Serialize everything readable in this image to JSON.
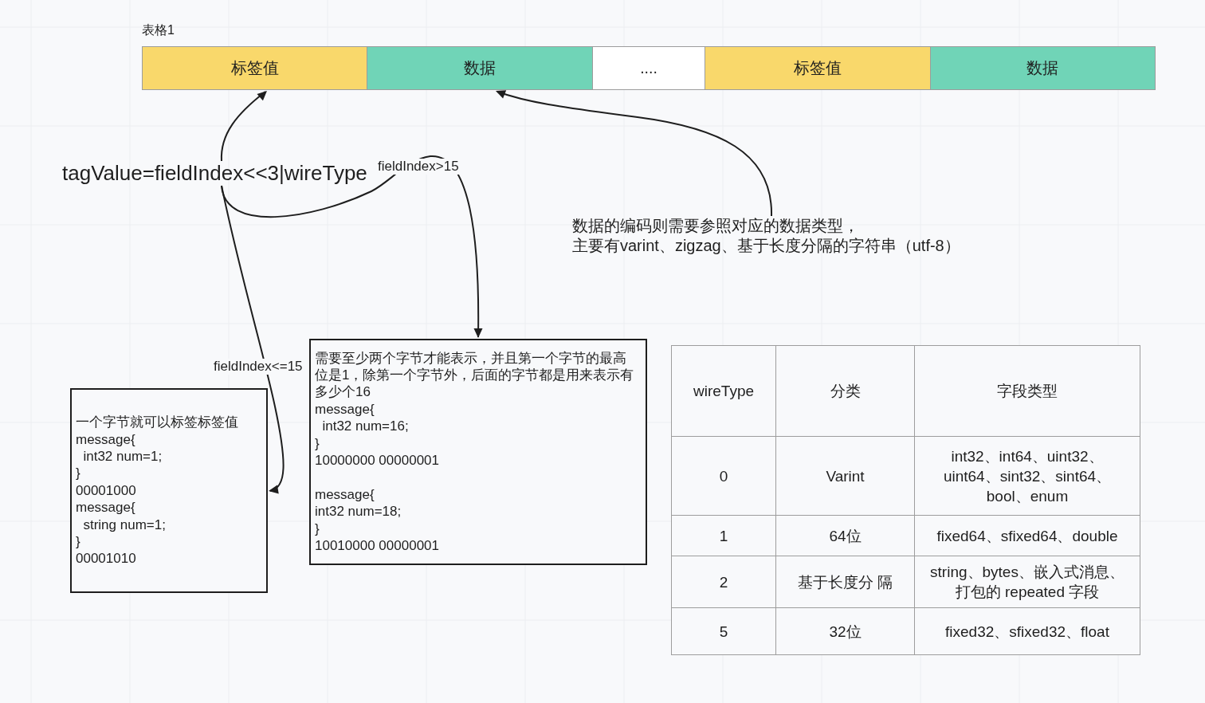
{
  "table_1": {
    "title": "表格1",
    "segments": [
      {
        "kind": "field",
        "text": "标签值",
        "color": "#f9d86b"
      },
      {
        "kind": "field",
        "text": "数据",
        "color": "#70d4b7"
      },
      {
        "kind": "ellipsis",
        "text": "...."
      },
      {
        "kind": "field",
        "text": "标签值",
        "color": "#f9d86b"
      },
      {
        "kind": "field",
        "text": "数据",
        "color": "#70d4b7"
      }
    ]
  },
  "formula": "tagValue=fieldIndex<<3|wireType",
  "connector_labels": [
    "fieldIndex>15",
    "fieldIndex<=15"
  ],
  "annotation": [
    "数据的编码则需要参照对应的数据类型，",
    "主要有varint、zigzag、基于长度分隔的字符串（utf-8）"
  ],
  "notes": [
    {
      "text": "一个字节就可以标签标签值\nmessage{\n  int32 num=1;\n}\n00001000\nmessage{\n  string num=1;\n}\n00001010"
    },
    {
      "text": "需要至少两个字节才能表示，并且第一个字节的最高位是1，除第一个字节外，后面的字节都是用来表示有多少个16\nmessage{\n  int32 num=16;\n}\n10000000 00000001\n\nmessage{\nint32 num=18;\n}\n10010000 00000001"
    }
  ],
  "wire_type_table": {
    "columns": [
      "wireType",
      "分类",
      "字段类型"
    ],
    "rows": [
      [
        "0",
        "Varint",
        "int32、int64、uint32、uint64、sint32、sint64、bool、enum"
      ],
      [
        "1",
        "64位",
        "fixed64、sfixed64、double"
      ],
      [
        "2",
        "基于长度分 隔",
        "string、bytes、嵌入式消息、打包的 repeated 字段"
      ],
      [
        "5",
        "32位",
        "fixed32、sfixed32、float"
      ]
    ]
  }
}
